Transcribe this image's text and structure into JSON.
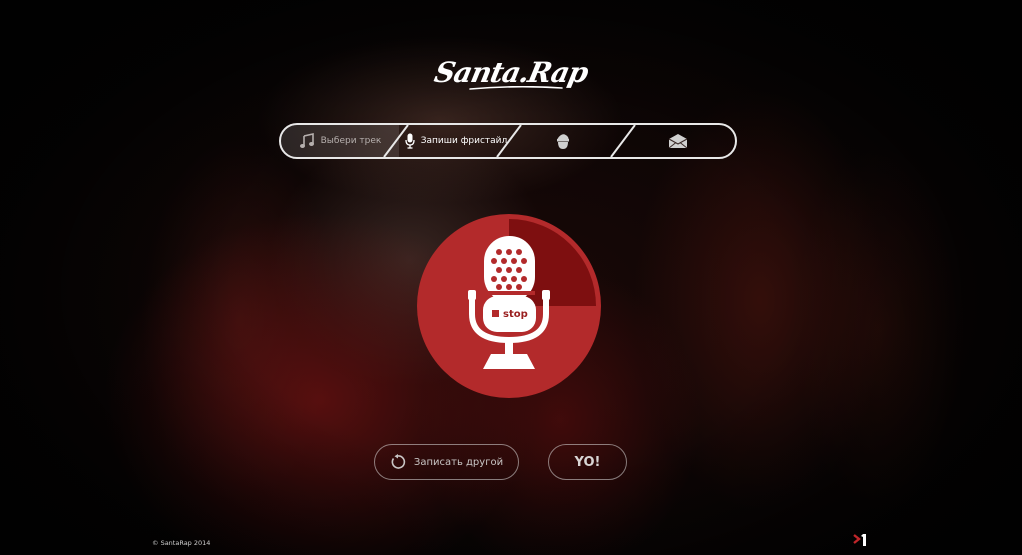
{
  "logo": {
    "text": "Santa.Rap"
  },
  "steps": [
    {
      "label": "Выбери трек",
      "icon": "music-note-icon"
    },
    {
      "label": "Запиши фристайл",
      "icon": "microphone-icon"
    },
    {
      "label": "",
      "icon": "santa-head-icon"
    },
    {
      "label": "",
      "icon": "envelope-icon"
    }
  ],
  "recorder": {
    "stop_label": "stop",
    "progress": 0.25,
    "colors": {
      "disc": "#b32a2b",
      "progress": "#7e0f10",
      "icon": "#ffffff"
    }
  },
  "actions": {
    "again_label": "Записать другой",
    "again_icon": "rotate-icon",
    "yo_label": "YO!"
  },
  "footer": {
    "copyright": "© SantaRap 2014",
    "brand_icon": "m1-logo-icon"
  }
}
